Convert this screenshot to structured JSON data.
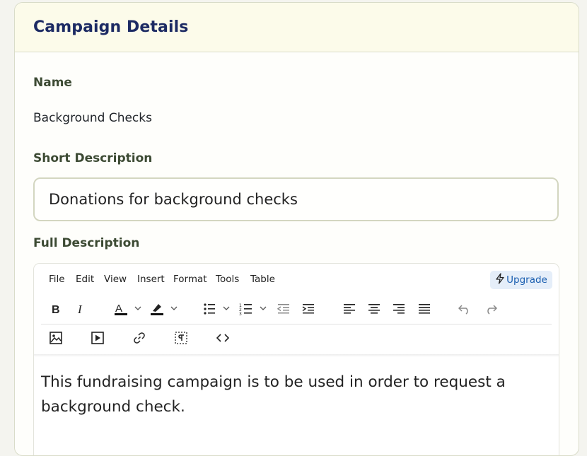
{
  "card": {
    "title": "Campaign Details"
  },
  "fields": {
    "name_label": "Name",
    "name_value": "Background Checks",
    "short_label": "Short Description",
    "short_value": "Donations for background checks",
    "full_label": "Full Description"
  },
  "editor": {
    "menu": [
      "File",
      "Edit",
      "View",
      "Insert",
      "Format",
      "Tools",
      "Table"
    ],
    "upgrade_label": "Upgrade",
    "toolbar_icons": [
      "bold-icon",
      "italic-icon",
      "text-color-icon",
      "highlight-color-icon",
      "bullet-list-icon",
      "numbered-list-icon",
      "outdent-icon",
      "indent-icon",
      "align-left-icon",
      "align-center-icon",
      "align-right-icon",
      "align-justify-icon",
      "undo-icon",
      "redo-icon",
      "image-icon",
      "media-icon",
      "link-icon",
      "show-blocks-icon",
      "source-code-icon"
    ],
    "content": "This fundraising campaign is to be used in order to request a background check."
  },
  "colors": {
    "header_bg": "#fcfbea",
    "title": "#1c2a63",
    "label": "#3c4a33",
    "upgrade_bg": "#e5eef9",
    "upgrade_text": "#1b5fb0"
  }
}
